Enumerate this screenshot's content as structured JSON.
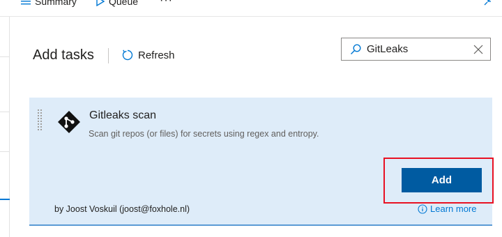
{
  "toolbar": {
    "summary_label": "Summary",
    "queue_label": "Queue",
    "more_label": "···"
  },
  "header": {
    "title": "Add tasks",
    "refresh_label": "Refresh"
  },
  "search": {
    "value": "GitLeaks"
  },
  "task": {
    "name": "Gitleaks scan",
    "description": "Scan git repos (or files) for secrets using regex and entropy.",
    "author": "by Joost Voskuil (joost@foxhole.nl)",
    "add_label": "Add",
    "learn_more_label": "Learn more"
  },
  "icons": {
    "summary": "list-icon",
    "queue": "play-icon",
    "collapse": "collapse-icon",
    "refresh": "refresh-icon",
    "search": "search-icon",
    "clear": "close-icon",
    "task_logo": "git-diamond-icon",
    "info": "info-icon",
    "drag": "drag-handle-icon"
  },
  "colors": {
    "accent": "#0078d4",
    "add_button": "#005ba1",
    "card_background": "#deecf9",
    "highlight_border": "#e81123"
  }
}
